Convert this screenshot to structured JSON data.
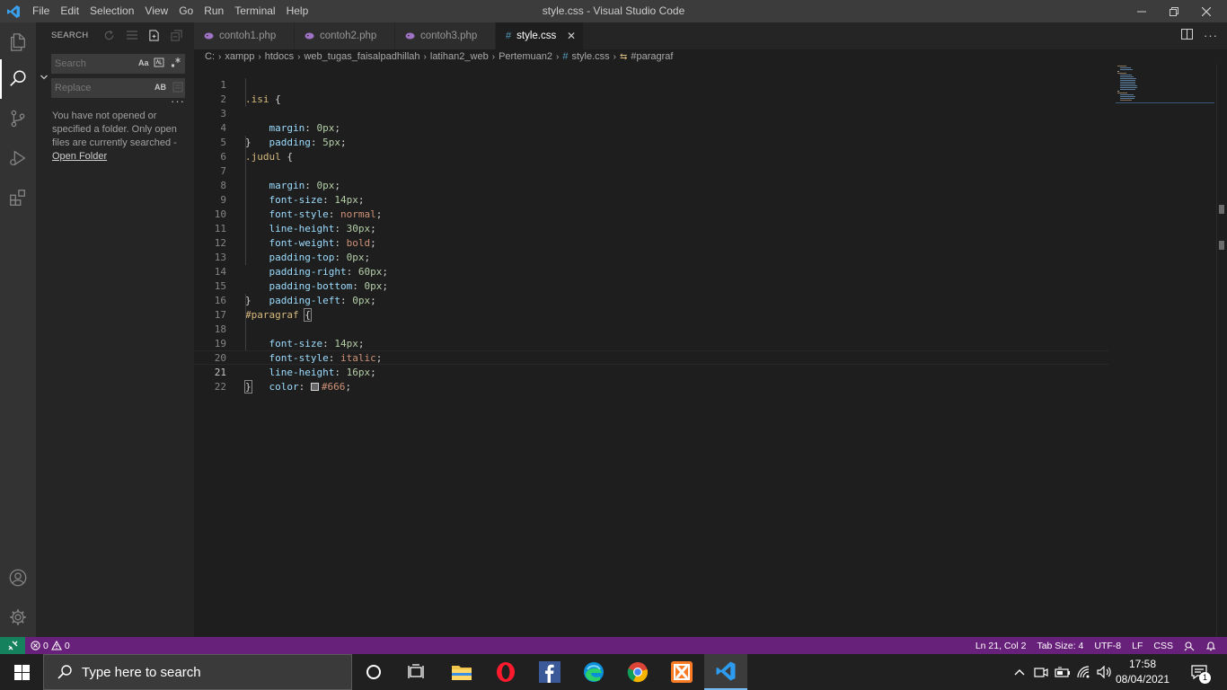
{
  "window": {
    "title": "style.css - Visual Studio Code",
    "menu": [
      "File",
      "Edit",
      "Selection",
      "View",
      "Go",
      "Run",
      "Terminal",
      "Help"
    ]
  },
  "sidebar": {
    "header": "SEARCH",
    "search_placeholder": "Search",
    "search_option": "Aa",
    "replace_placeholder": "Replace",
    "replace_option": "AB",
    "more": "···",
    "message": "You have not opened or specified a folder. Only open files are currently searched -",
    "open_folder_link": "Open Folder"
  },
  "tabs": [
    {
      "label": "contoh1.php",
      "active": false
    },
    {
      "label": "contoh2.php",
      "active": false
    },
    {
      "label": "contoh3.php",
      "active": false
    },
    {
      "label": "style.css",
      "active": true
    }
  ],
  "breadcrumb": [
    "C:",
    "xampp",
    "htdocs",
    "web_tugas_faisalpadhillah",
    "latihan2_web",
    "Pertemuan2",
    "style.css",
    "#paragraf"
  ],
  "editor": {
    "line_numbers": [
      "1",
      "2",
      "3",
      "4",
      "5",
      "6",
      "7",
      "8",
      "9",
      "10",
      "11",
      "12",
      "13",
      "14",
      "15",
      "16",
      "17",
      "18",
      "19",
      "20",
      "21",
      "22"
    ],
    "current_line": 21,
    "code": {
      "l1_sel": ".isi",
      "l2_prop": "margin",
      "l2_val": "0px",
      "l3_prop": "padding",
      "l3_val": "5px",
      "l5_sel": ".judul",
      "l6_prop": "margin",
      "l6_val": "0px",
      "l7_prop": "font-size",
      "l7_val": "14px",
      "l8_prop": "font-style",
      "l8_val": "normal",
      "l9_prop": "line-height",
      "l9_val": "30px",
      "l10_prop": "font-weight",
      "l10_val": "bold",
      "l11_prop": "padding-top",
      "l11_val": "0px",
      "l12_prop": "padding-right",
      "l12_val": "60px",
      "l13_prop": "padding-bottom",
      "l13_val": "0px",
      "l14_prop": "padding-left",
      "l14_val": "0px",
      "l16_sel": "#paragraf",
      "l17_prop": "font-size",
      "l17_val": "14px",
      "l18_prop": "font-style",
      "l18_val": "italic",
      "l19_prop": "line-height",
      "l19_val": "16px",
      "l20_prop": "color",
      "l20_val": "#666",
      "open_brace": "{",
      "close_brace": "}",
      "colon": ":",
      "semicolon": ";"
    }
  },
  "statusbar": {
    "errors": "0",
    "warnings": "0",
    "position": "Ln 21, Col 2",
    "tab_size": "Tab Size: 4",
    "encoding": "UTF-8",
    "eol": "LF",
    "language": "CSS"
  },
  "taskbar": {
    "search_placeholder": "Type here to search",
    "time": "17:58",
    "date": "08/04/2021",
    "notification_count": "1"
  },
  "colors": {
    "statusbar": "#68217a",
    "remote": "#16825d",
    "activitybar": "#333333",
    "sidebar": "#252526",
    "editor": "#1e1e1e"
  }
}
